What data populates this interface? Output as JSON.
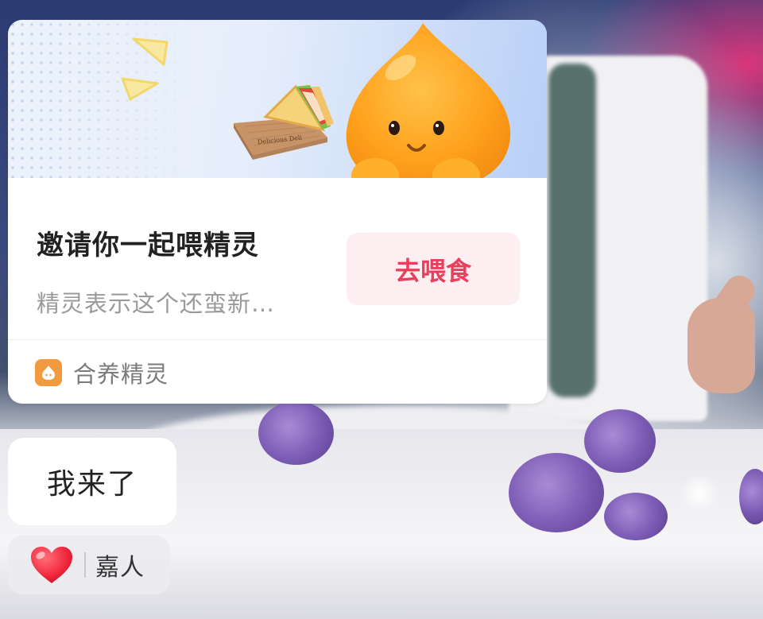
{
  "card": {
    "title": "邀请你一起喂精灵",
    "subtitle": "精灵表示这个还蛮新…",
    "button_label": "去喂食",
    "app_name": "合养精灵",
    "banner": {
      "mascot_icon": "orange-drop-mascot",
      "food_icon": "sandwich-icon",
      "food_box_text": "Delicious Deli"
    }
  },
  "message": {
    "text": "我来了"
  },
  "reaction": {
    "icon": "heart-icon",
    "name": "嘉人"
  },
  "colors": {
    "accent": "#e8405c",
    "button_bg": "#fdeef1",
    "app_icon": "#f29a3f"
  }
}
